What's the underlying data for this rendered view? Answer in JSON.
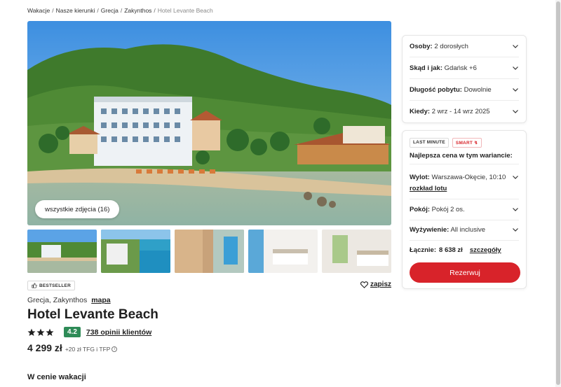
{
  "breadcrumb": {
    "items": [
      "Wakacje",
      "Nasze kierunki",
      "Grecja",
      "Zakynthos"
    ],
    "current": "Hotel Levante Beach",
    "separator": "/"
  },
  "gallery": {
    "all_photos_label": "wszystkie zdjęcia (16)"
  },
  "hotel": {
    "bestseller_label": "BESTSELLER",
    "save_label": "zapisz",
    "location": "Grecja, Zakynthos",
    "map_label": "mapa",
    "name": "Hotel Levante Beach",
    "stars": 3,
    "rating": "4.2",
    "reviews_label": "738 opinii klientów",
    "price": "4 299 zł",
    "price_extra": "+20 zł TFG i TFP",
    "section_title": "W cenie wakacji"
  },
  "search_panel": {
    "rows": [
      {
        "label": "Osoby:",
        "value": "2 dorosłych"
      },
      {
        "label": "Skąd i jak:",
        "value": "Gdańsk +6"
      },
      {
        "label": "Długość pobytu:",
        "value": "Dowolnie"
      },
      {
        "label": "Kiedy:",
        "value": "2 wrz - 14 wrz 2025"
      }
    ]
  },
  "offer_panel": {
    "badge_last_minute": "LAST MINUTE",
    "badge_smart": "SMART",
    "best_price_label": "Najlepsza cena w tym wariancie:",
    "flight": {
      "label": "Wylot:",
      "value": "Warszawa-Okęcie, 10:10"
    },
    "flight_link": "rozkład lotu",
    "room": {
      "label": "Pokój:",
      "value": "Pokój 2 os."
    },
    "board": {
      "label": "Wyżywienie:",
      "value": "All inclusive"
    },
    "total_label": "Łącznie:",
    "total_value": "8 638 zł",
    "details_label": "szczegóły",
    "reserve_label": "Rezerwuj"
  },
  "colors": {
    "accent_red": "#d8232a",
    "rating_green": "#2e8b57"
  }
}
